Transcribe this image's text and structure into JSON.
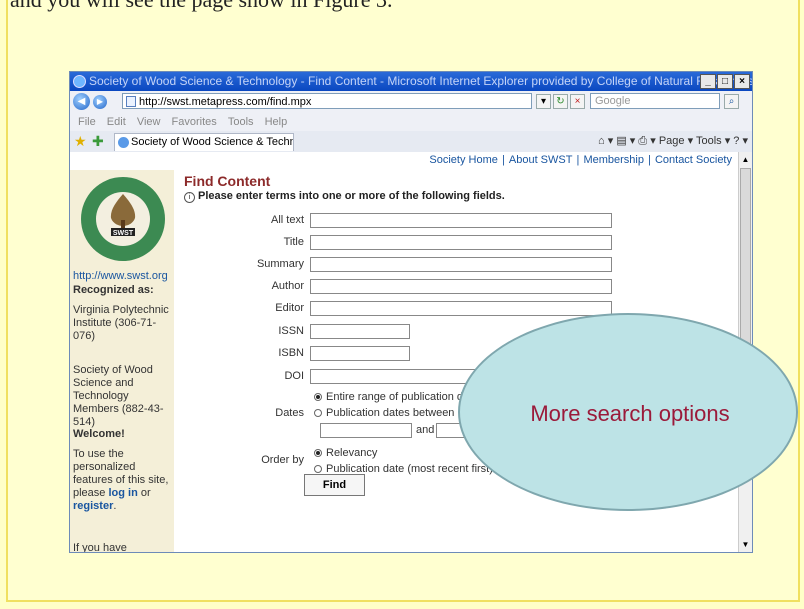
{
  "slide": {
    "top_text": "and you will see the page show in Figure 3."
  },
  "window": {
    "title": "Society of Wood Science & Technology - Find Content - Microsoft Internet Explorer provided by College of Natural Resources",
    "url": "http://swst.metapress.com/find.mpx",
    "search_placeholder": "Google",
    "menu": [
      "File",
      "Edit",
      "View",
      "Favorites",
      "Tools",
      "Help"
    ],
    "tab_label": "Society of Wood Science & Technology - ...",
    "toolbar_text": "Page ▾  Tools ▾"
  },
  "toplinks": [
    "Society Home",
    "About SWST",
    "Membership",
    "Contact Society"
  ],
  "sidebar": {
    "logo_text": "SWST",
    "url": "http://www.swst.org",
    "recognized_heading": "Recognized as:",
    "vt_text": "Virginia Polytechnic Institute (306-71-076)",
    "swst_text": "Society of Wood Science and Technology Members (882-43-514)",
    "welcome_heading": "Welcome!",
    "welcome_text": "To use the personalized features of this site, please",
    "login_link": "log in",
    "or_text": "or",
    "register_link": "register",
    "if_text": "If you have"
  },
  "form": {
    "title": "Find Content",
    "instructions": "Please enter terms into one or more of the following fields.",
    "labels": {
      "all_text": "All text",
      "title": "Title",
      "summary": "Summary",
      "author": "Author",
      "editor": "Editor",
      "issn": "ISSN",
      "isbn": "ISBN",
      "doi": "DOI",
      "dates": "Dates",
      "order_by": "Order by"
    },
    "dates_options": [
      "Entire range of publication dates",
      "Publication dates between"
    ],
    "dates_and": "and",
    "order_options": [
      "Relevancy",
      "Publication date (most recent first)"
    ],
    "find_button": "Find"
  },
  "callout": {
    "text": "More search options"
  },
  "colors": {
    "slide_bg": "#ffffc8",
    "callout_fill": "#bde3e6",
    "callout_text": "#9b1a3a",
    "title_red": "#8c2a2a",
    "link_blue": "#1a56a0"
  }
}
